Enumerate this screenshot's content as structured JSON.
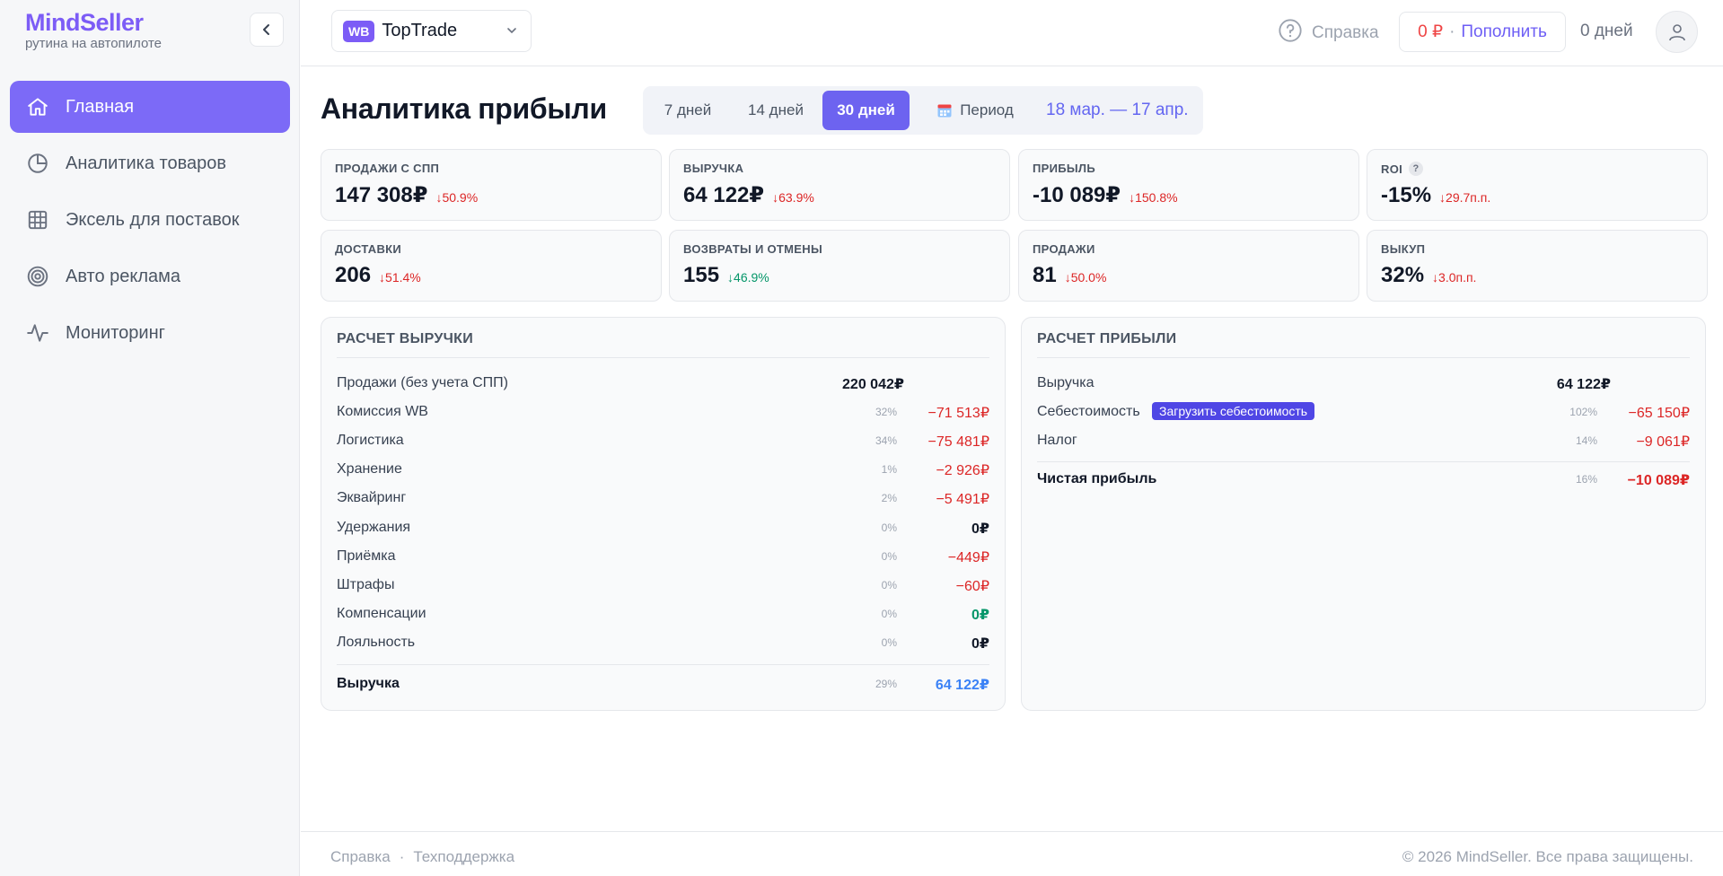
{
  "brand": {
    "name": "MindSeller",
    "tagline": "рутина на автопилоте"
  },
  "sidebar": {
    "items": [
      {
        "label": "Главная",
        "icon": "home-icon",
        "active": true
      },
      {
        "label": "Аналитика товаров",
        "icon": "pie-chart-icon"
      },
      {
        "label": "Эксель для поставок",
        "icon": "table-grid-icon"
      },
      {
        "label": "Авто реклама",
        "icon": "target-icon"
      },
      {
        "label": "Мониторинг",
        "icon": "activity-icon"
      }
    ]
  },
  "header": {
    "shop_badge": "WB",
    "shop_name": "TopTrade",
    "help_label": "Справка",
    "balance_amount": "0 ₽",
    "balance_sep": "·",
    "topup_label": "Пополнить",
    "days_label": "0 дней"
  },
  "page": {
    "title": "Аналитика прибыли",
    "periods": [
      "7 дней",
      "14 дней",
      "30 дней"
    ],
    "active_period": "30 дней",
    "period_button": "Период",
    "date_range": "18 мар. — 17 апр."
  },
  "kpis": [
    {
      "label": "ПРОДАЖИ С СПП",
      "value": "147 308₽",
      "delta": "↓50.9%",
      "trend": "down-bad"
    },
    {
      "label": "ВЫРУЧКА",
      "value": "64 122₽",
      "delta": "↓63.9%",
      "trend": "down-bad"
    },
    {
      "label": "ПРИБЫЛЬ",
      "value": "-10 089₽",
      "delta": "↓150.8%",
      "trend": "down-bad"
    },
    {
      "label": "ROI",
      "value": "-15%",
      "delta": "↓29.7п.п.",
      "trend": "down-bad",
      "help": "?"
    },
    {
      "label": "ДОСТАВКИ",
      "value": "206",
      "delta": "↓51.4%",
      "trend": "down-bad"
    },
    {
      "label": "ВОЗВРАТЫ И ОТМЕНЫ",
      "value": "155",
      "delta": "↓46.9%",
      "trend": "down-good"
    },
    {
      "label": "ПРОДАЖИ",
      "value": "81",
      "delta": "↓50.0%",
      "trend": "down-bad"
    },
    {
      "label": "ВЫКУП",
      "value": "32%",
      "delta": "↓3.0п.п.",
      "trend": "down-bad"
    }
  ],
  "revenue_calc": {
    "title": "РАСЧЕТ ВЫРУЧКИ",
    "rows": [
      {
        "label": "Продажи (без учета СПП)",
        "pct": "",
        "value": "220 042₽",
        "kind": "plain"
      },
      {
        "label": "Комиссия WB",
        "pct": "32%",
        "value": "−71 513₽",
        "kind": "neg"
      },
      {
        "label": "Логистика",
        "pct": "34%",
        "value": "−75 481₽",
        "kind": "neg"
      },
      {
        "label": "Хранение",
        "pct": "1%",
        "value": "−2 926₽",
        "kind": "neg"
      },
      {
        "label": "Эквайринг",
        "pct": "2%",
        "value": "−5 491₽",
        "kind": "neg"
      },
      {
        "label": "Удержания",
        "pct": "0%",
        "value": "0₽",
        "kind": "zero"
      },
      {
        "label": "Приёмка",
        "pct": "0%",
        "value": "−449₽",
        "kind": "neg"
      },
      {
        "label": "Штрафы",
        "pct": "0%",
        "value": "−60₽",
        "kind": "neg"
      },
      {
        "label": "Компенсации",
        "pct": "0%",
        "value": "0₽",
        "kind": "zgreen"
      },
      {
        "label": "Лояльность",
        "pct": "0%",
        "value": "0₽",
        "kind": "zero"
      }
    ],
    "total": {
      "label": "Выручка",
      "pct": "29%",
      "value": "64 122₽"
    }
  },
  "profit_calc": {
    "title": "РАСЧЕТ ПРИБЫЛИ",
    "rows": [
      {
        "label": "Выручка",
        "pct": "",
        "value": "64 122₽",
        "kind": "plain"
      },
      {
        "label": "Себестоимость",
        "pct": "102%",
        "value": "−65 150₽",
        "kind": "neg",
        "action": "Загрузить себестоимость"
      },
      {
        "label": "Налог",
        "pct": "14%",
        "value": "−9 061₽",
        "kind": "neg"
      }
    ],
    "total": {
      "label": "Чистая прибыль",
      "pct": "16%",
      "value": "−10 089₽"
    }
  },
  "footer": {
    "links": [
      "Справка",
      "Техподдержка"
    ],
    "link_sep": "·",
    "copyright": "© 2026 MindSeller. Все права защищены."
  },
  "colors": {
    "accent": "#7c5cf6",
    "active_nav": "#7c6af7",
    "negative": "#dc2626",
    "positive": "#059669",
    "link": "#6366f1"
  }
}
